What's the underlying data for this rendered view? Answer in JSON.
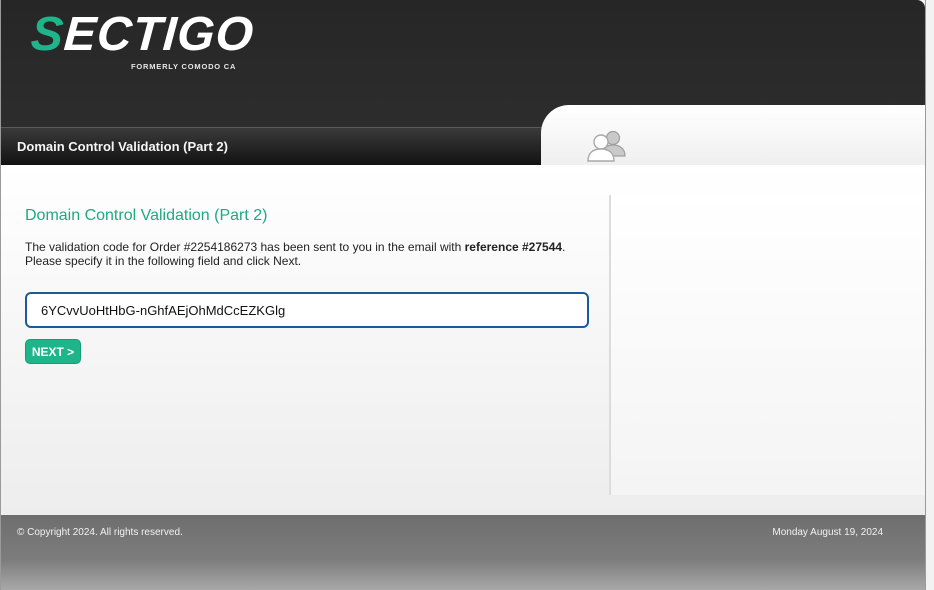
{
  "brand": {
    "logo_s": "S",
    "logo_rest": "ECTIGO",
    "tagline": "FORMERLY COMODO CA",
    "accent_color": "#1fb58a"
  },
  "header": {
    "title": "Domain Control Validation (Part 2)",
    "icon": "users-icon"
  },
  "main": {
    "title": "Domain Control Validation (Part 2)",
    "desc_part1": "The validation code for Order #2254186273 has been sent to you in the email with ",
    "desc_bold": "reference #27544",
    "desc_part2": ".",
    "desc_line2": "Please specify it in the following field and click Next.",
    "code_value": "6YCvvUoHtHbG-nGhfAEjOhMdCcEZKGlg",
    "next_label": "NEXT >"
  },
  "footer": {
    "copyright": "© Copyright 2024. All rights reserved.",
    "date": "Monday August 19, 2024"
  }
}
